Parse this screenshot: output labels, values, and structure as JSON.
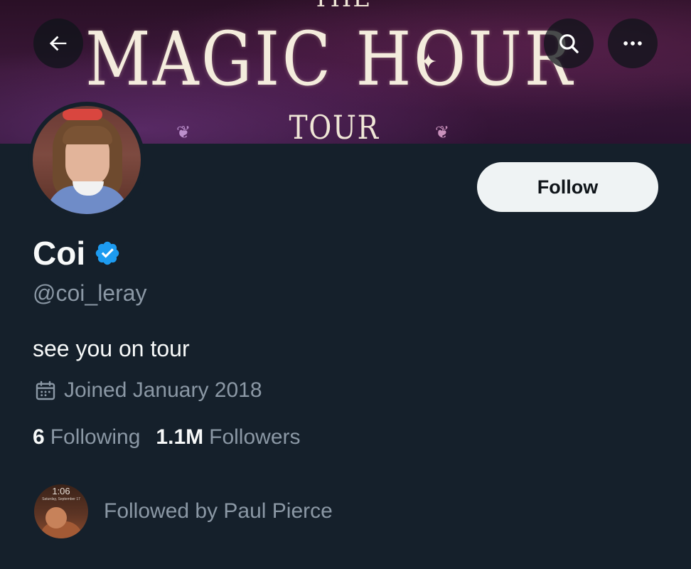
{
  "banner": {
    "the_text": "THE",
    "title": "MAGIC HOUR",
    "subtitle": "TOUR"
  },
  "nav": {
    "back_icon": "arrow-left-icon",
    "search_icon": "search-icon",
    "more_icon": "more-horizontal-icon"
  },
  "profile": {
    "display_name": "Coi",
    "verified": true,
    "verified_color": "#1d9bf0",
    "handle": "@coi_leray",
    "bio": "see you on tour",
    "joined": "Joined January 2018",
    "follow_label": "Follow"
  },
  "stats": {
    "following_count": "6",
    "following_label": "Following",
    "followers_count": "1.1M",
    "followers_label": "Followers"
  },
  "followed_by": {
    "text": "Followed by Paul Pierce",
    "avatar_time": "1:06",
    "avatar_date": "Saturday, September 17"
  },
  "colors": {
    "background": "#15202b",
    "primary_text": "#f7f9f9",
    "secondary_text": "#8b98a5",
    "button_bg": "#eff3f4",
    "button_text": "#0f1419"
  }
}
